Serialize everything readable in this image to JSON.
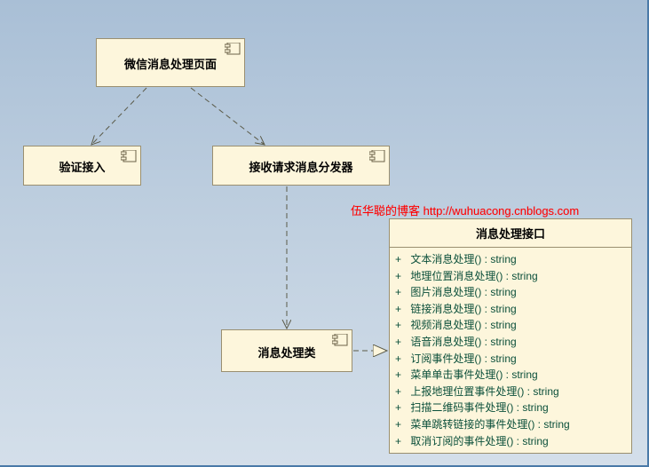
{
  "watermark": "伍华聪的博客 http://wuhuacong.cnblogs.com",
  "nodes": {
    "page": {
      "label": "微信消息处理页面"
    },
    "verify": {
      "label": "验证接入"
    },
    "dispatcher": {
      "label": "接收请求消息分发器"
    },
    "handler": {
      "label": "消息处理类"
    },
    "iface": {
      "title": "消息处理接口",
      "ops": [
        {
          "name": "文本消息处理()",
          "ret": "string"
        },
        {
          "name": "地理位置消息处理()",
          "ret": "string"
        },
        {
          "name": "图片消息处理()",
          "ret": "string"
        },
        {
          "name": "链接消息处理()",
          "ret": "string"
        },
        {
          "name": "视频消息处理()",
          "ret": "string"
        },
        {
          "name": "语音消息处理()",
          "ret": "string"
        },
        {
          "name": "订阅事件处理()",
          "ret": "string"
        },
        {
          "name": "菜单单击事件处理()",
          "ret": "string"
        },
        {
          "name": "上报地理位置事件处理()",
          "ret": "string"
        },
        {
          "name": "扫描二维码事件处理()",
          "ret": "string"
        },
        {
          "name": "菜单跳转链接的事件处理()",
          "ret": "string"
        },
        {
          "name": "取消订阅的事件处理()",
          "ret": "string"
        }
      ]
    }
  }
}
